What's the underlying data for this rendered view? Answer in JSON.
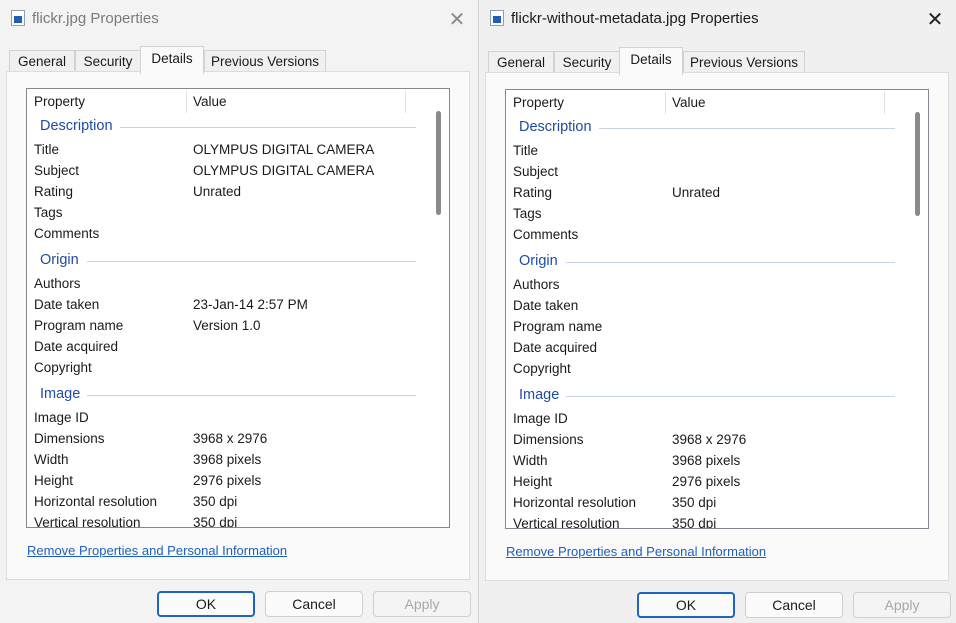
{
  "left": {
    "title": "flickr.jpg Properties",
    "tabs": [
      "General",
      "Security",
      "Details",
      "Previous Versions"
    ],
    "active_tab": "Details",
    "header": {
      "property": "Property",
      "value": "Value"
    },
    "groups": {
      "description": "Description",
      "origin": "Origin",
      "image": "Image"
    },
    "rows": [
      {
        "p": "Title",
        "v": "OLYMPUS DIGITAL CAMERA"
      },
      {
        "p": "Subject",
        "v": "OLYMPUS DIGITAL CAMERA"
      },
      {
        "p": "Rating",
        "v": "Unrated"
      },
      {
        "p": "Tags",
        "v": ""
      },
      {
        "p": "Comments",
        "v": ""
      },
      {
        "p": "Authors",
        "v": ""
      },
      {
        "p": "Date taken",
        "v": "23-Jan-14 2:57 PM"
      },
      {
        "p": "Program name",
        "v": "Version 1.0"
      },
      {
        "p": "Date acquired",
        "v": ""
      },
      {
        "p": "Copyright",
        "v": ""
      },
      {
        "p": "Image ID",
        "v": ""
      },
      {
        "p": "Dimensions",
        "v": "3968 x 2976"
      },
      {
        "p": "Width",
        "v": "3968 pixels"
      },
      {
        "p": "Height",
        "v": "2976 pixels"
      },
      {
        "p": "Horizontal resolution",
        "v": "350 dpi"
      },
      {
        "p": "Vertical resolution",
        "v": "350 dpi"
      }
    ],
    "link": "Remove Properties and Personal Information",
    "buttons": {
      "ok": "OK",
      "cancel": "Cancel",
      "apply": "Apply"
    }
  },
  "right": {
    "title": "flickr-without-metadata.jpg Properties",
    "tabs": [
      "General",
      "Security",
      "Details",
      "Previous Versions"
    ],
    "active_tab": "Details",
    "header": {
      "property": "Property",
      "value": "Value"
    },
    "groups": {
      "description": "Description",
      "origin": "Origin",
      "image": "Image"
    },
    "rows": [
      {
        "p": "Title",
        "v": ""
      },
      {
        "p": "Subject",
        "v": ""
      },
      {
        "p": "Rating",
        "v": "Unrated"
      },
      {
        "p": "Tags",
        "v": ""
      },
      {
        "p": "Comments",
        "v": ""
      },
      {
        "p": "Authors",
        "v": ""
      },
      {
        "p": "Date taken",
        "v": ""
      },
      {
        "p": "Program name",
        "v": ""
      },
      {
        "p": "Date acquired",
        "v": ""
      },
      {
        "p": "Copyright",
        "v": ""
      },
      {
        "p": "Image ID",
        "v": ""
      },
      {
        "p": "Dimensions",
        "v": "3968 x 2976"
      },
      {
        "p": "Width",
        "v": "3968 pixels"
      },
      {
        "p": "Height",
        "v": "2976 pixels"
      },
      {
        "p": "Horizontal resolution",
        "v": "350 dpi"
      },
      {
        "p": "Vertical resolution",
        "v": "350 dpi"
      }
    ],
    "link": "Remove Properties and Personal Information",
    "buttons": {
      "ok": "OK",
      "cancel": "Cancel",
      "apply": "Apply"
    }
  },
  "icons": {
    "file": "image-file-icon",
    "close": "close-icon"
  },
  "colors": {
    "group_heading": "#1f4aa5",
    "link": "#1e5fbd",
    "default_button_border": "#1f63c4"
  }
}
